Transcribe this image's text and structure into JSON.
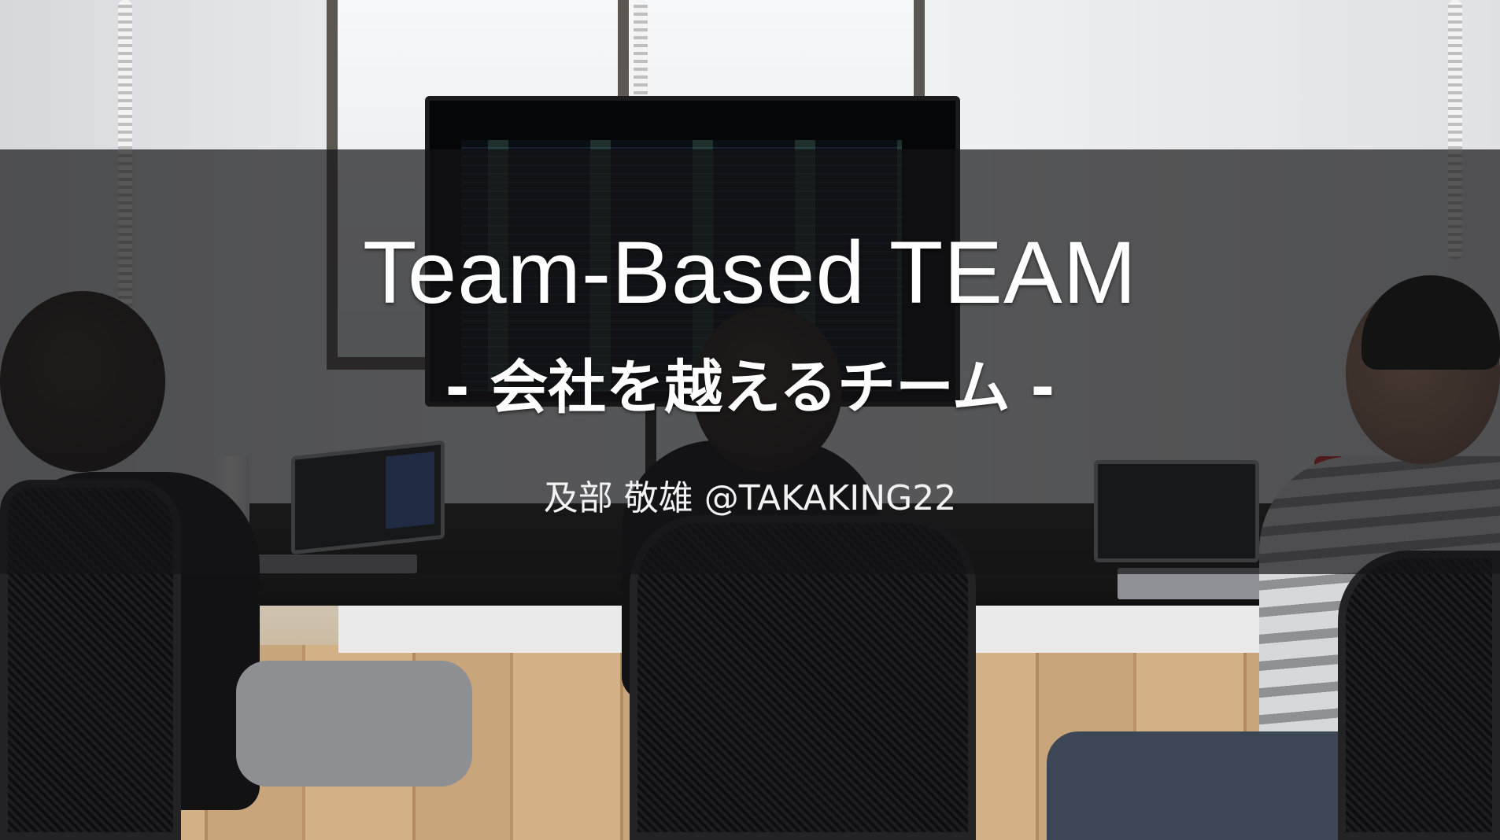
{
  "slide": {
    "title": "Team-Based TEAM",
    "subtitle": "- 会社を越えるチーム -",
    "author": "及部 敬雄 @TAKAKING22"
  },
  "colors": {
    "overlay": "#141416",
    "text": "#ffffff"
  }
}
